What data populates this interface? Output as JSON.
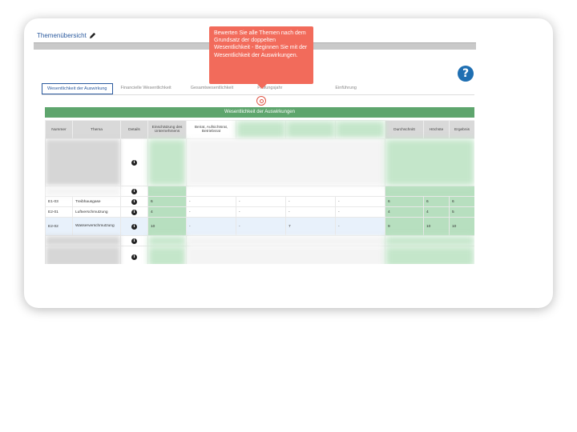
{
  "page": {
    "title": "Themenübersicht",
    "tabs": [
      "Wesentlichkeit der Auswirkung",
      "Financielle Wesentlichkeit",
      "Gesamtwesentlichkeit",
      "Prüfungsjahr",
      "Einführung"
    ],
    "tooltip": "Bewerten Sie alle Themen nach dem Grundsatz der doppelten Wesentlichkeit - Beginnen Sie mit der Wesentlichkeit der Auswirkungen."
  },
  "table": {
    "section_title": "Wesentlichkeit der Auswirkungen",
    "columns": [
      "Nummer",
      "Thema",
      "Details",
      "Einschätzung des Unternehmens",
      "Beirat, Aufsichtsrat, Betriebsrat",
      "",
      "",
      "",
      "Durchschnitt",
      "Höchste",
      "Ergebnis"
    ],
    "rows": [
      {
        "nummer": "E1-03",
        "thema": "Treibhausgase",
        "vals": [
          "6",
          "-",
          "-",
          "-",
          "-",
          "6",
          "6",
          "6"
        ]
      },
      {
        "nummer": "E2-01",
        "thema": "Luftverschmutzung",
        "vals": [
          "4",
          "-",
          "-",
          "-",
          "-",
          "4",
          "4",
          "5"
        ]
      },
      {
        "nummer": "E2-02",
        "thema": "Wasserverschmutzung",
        "vals": [
          "10",
          "-",
          "-",
          "7",
          "-",
          "9",
          "10",
          "10"
        ]
      }
    ],
    "info_glyph": "i"
  }
}
